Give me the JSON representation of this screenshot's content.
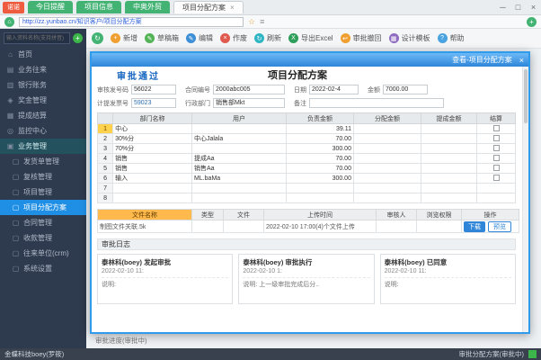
{
  "titlebar": {
    "badge": "诺诺",
    "tabs": [
      "今日提醒",
      "项目信息",
      "中奥外贸",
      "项目分配方案"
    ],
    "tab_close": "×",
    "window_min": "─",
    "window_max": "□",
    "window_close": "×"
  },
  "urlbar": {
    "nav_icon": "⌂",
    "url": "http://zz.yunbao.cn/知识客户/项目分配方案",
    "star_icon": "☆",
    "menu_icon": "≡",
    "add_icon": "+"
  },
  "toolbar": {
    "back_icon": "↻",
    "buttons": [
      {
        "label": "新增",
        "icon": "+",
        "color": "#f0a030"
      },
      {
        "label": "草稿箱",
        "icon": "✎",
        "color": "#52b456"
      },
      {
        "label": "编辑",
        "icon": "✎",
        "color": "#3d8fd6"
      },
      {
        "label": "作废",
        "icon": "×",
        "color": "#e05b4f"
      },
      {
        "label": "刷新",
        "icon": "↻",
        "color": "#2fb5c4"
      },
      {
        "label": "导出Excel",
        "icon": "X",
        "color": "#2e9e5b"
      },
      {
        "label": "审批撤回",
        "icon": "↩",
        "color": "#f0a030"
      },
      {
        "label": "设计模板",
        "icon": "▦",
        "color": "#8e6bc0"
      },
      {
        "label": "帮助",
        "icon": "?",
        "color": "#4aa3e0"
      }
    ]
  },
  "sidebar": {
    "search_placeholder": "输入资料名称(支持拼音)",
    "add_icon": "+",
    "items": [
      {
        "label": "首页",
        "icon": "⌂"
      },
      {
        "label": "业务往来",
        "icon": "▤"
      },
      {
        "label": "银行账务",
        "icon": "▥"
      },
      {
        "label": "奖金管理",
        "icon": "◈"
      },
      {
        "label": "提成结算",
        "icon": "▦"
      },
      {
        "label": "监控中心",
        "icon": "◎"
      },
      {
        "label": "业务管理",
        "icon": "▣"
      },
      {
        "label": "发货单管理",
        "icon": "▢"
      },
      {
        "label": "复核管理",
        "icon": "▢"
      },
      {
        "label": "项目管理",
        "icon": "▢"
      },
      {
        "label": "项目分配方案",
        "icon": "▢"
      },
      {
        "label": "合同管理",
        "icon": "▢"
      },
      {
        "label": "收款管理",
        "icon": "▢"
      },
      {
        "label": "往来单位(crm)",
        "icon": "▢"
      },
      {
        "label": "系统设置",
        "icon": "▢"
      }
    ]
  },
  "main": {
    "bottom_text": "审批进度(审批中)"
  },
  "dialog": {
    "title": "查看-项目分配方案",
    "close": "×",
    "status": "审批通过",
    "heading": "项目分配方案",
    "fields": {
      "row1": [
        {
          "label": "审核发号码",
          "value": "56022"
        },
        {
          "label": "合同编号",
          "value": "2000abc005"
        },
        {
          "label": "日期",
          "value": "2022-02-4"
        },
        {
          "label": "金额",
          "value": "7000.00"
        }
      ],
      "row2": [
        {
          "label": "计提发票号",
          "value": "59023"
        },
        {
          "label": "行政部门",
          "value": "销售部Mkt"
        },
        {
          "label": "备注",
          "value": ""
        }
      ]
    },
    "table": {
      "headers": [
        "",
        "部门名称",
        "用户",
        "负责金额",
        "分配金额",
        "提成金额",
        "结算"
      ],
      "rows": [
        {
          "seq": "1",
          "dept": "中心",
          "user": "",
          "amount": "39.11"
        },
        {
          "seq": "2",
          "dept": "30%分",
          "user": "中心Jalala",
          "amount": "70.00"
        },
        {
          "seq": "3",
          "dept": "70%分",
          "user": "",
          "amount": "300.00"
        },
        {
          "seq": "4",
          "dept": "销售",
          "user": "提成Aa",
          "amount": "70.00"
        },
        {
          "seq": "5",
          "dept": "销售",
          "user": "销售Aa",
          "amount": "70.00"
        },
        {
          "seq": "6",
          "dept": "输入",
          "user": "ML.baMa",
          "amount": "300.00"
        },
        {
          "seq": "7",
          "dept": "",
          "user": "",
          "amount": ""
        },
        {
          "seq": "8",
          "dept": "",
          "user": "",
          "amount": ""
        }
      ]
    },
    "files": {
      "headers": [
        "文件名称",
        "类型",
        "文件",
        "上传时间",
        "审核人",
        "浏览权限",
        "操作"
      ],
      "row": {
        "name": "制图文件关联.5k",
        "time": "2022-02-10 17:00(4)个文件上传",
        "download": "下载",
        "preview": "预览"
      }
    },
    "logs": {
      "title": "审批日志",
      "cards": [
        {
          "title": "泰林科(boey) 发起审批",
          "time": "2022-02-10 11:",
          "body": "说明:"
        },
        {
          "title": "泰林科(boey) 审批执行",
          "time": "2022-02-10 1:",
          "body": "说明: 上一级审批完成后分.."
        },
        {
          "title": "泰林科(boey) 已同意",
          "time": "2022-02-10 11:",
          "body": "说明:"
        }
      ]
    }
  },
  "statusbar": {
    "left": "金蝶科技boey(罗筱)",
    "right": "审批分配方案(审批中)"
  }
}
